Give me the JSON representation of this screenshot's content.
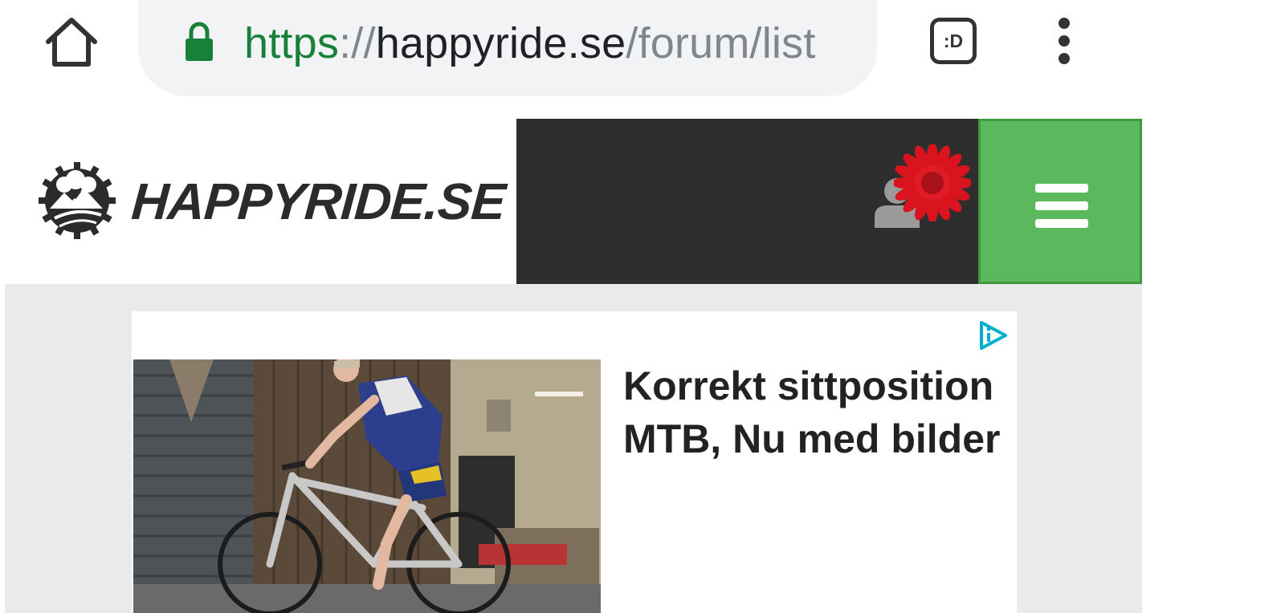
{
  "browser": {
    "url_scheme": "https",
    "url_separator": "://",
    "url_host": "happyride.se",
    "url_path": "/forum/list",
    "tab_switcher_label": ":D",
    "icons": [
      "home-icon",
      "lock-icon",
      "tab-switcher-icon",
      "more-vert-icon"
    ]
  },
  "site": {
    "logo_text": "HAPPYRIDE.SE",
    "icons": [
      "logo-badge-icon",
      "user-icon",
      "flower-icon",
      "hamburger-menu-icon"
    ],
    "colors": {
      "header_dark": "#2e2e2e",
      "menu_green": "#5cb85c",
      "flower_red": "#d9141e"
    }
  },
  "ad": {
    "headline": "Korrekt sittposition MTB, Nu med bilder",
    "icons": [
      "ad-choices-icon"
    ]
  }
}
